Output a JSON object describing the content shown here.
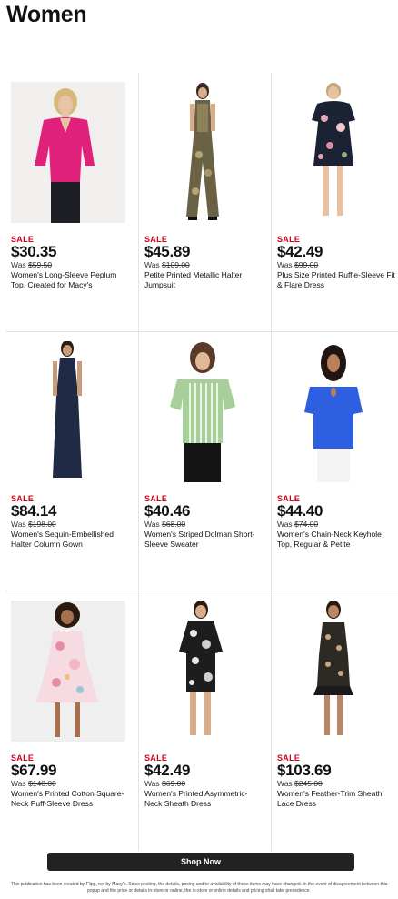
{
  "page": {
    "title": "Women"
  },
  "products": [
    {
      "sale": "SALE",
      "price": "$30.35",
      "was_label": "Was",
      "was_price": "$59.50",
      "name": "Women's Long-Sleeve Peplum Top, Created for Macy's",
      "image": "pink-peplum-top-model"
    },
    {
      "sale": "SALE",
      "price": "$45.89",
      "was_label": "Was",
      "was_price": "$109.00",
      "name": "Petite Printed Metallic Halter Jumpsuit",
      "image": "printed-halter-jumpsuit-model"
    },
    {
      "sale": "SALE",
      "price": "$42.49",
      "was_label": "Was",
      "was_price": "$99.00",
      "name": "Plus Size Printed Ruffle-Sleeve Fit & Flare Dress",
      "image": "floral-flare-dress-model"
    },
    {
      "sale": "SALE",
      "price": "$84.14",
      "was_label": "Was",
      "was_price": "$198.00",
      "name": "Women's Sequin-Embellished Halter Column Gown",
      "image": "navy-halter-gown-model"
    },
    {
      "sale": "SALE",
      "price": "$40.46",
      "was_label": "Was",
      "was_price": "$68.00",
      "name": "Women's Striped Dolman Short-Sleeve Sweater",
      "image": "green-striped-sweater-model"
    },
    {
      "sale": "SALE",
      "price": "$44.40",
      "was_label": "Was",
      "was_price": "$74.00",
      "name": "Women's Chain-Neck Keyhole Top, Regular & Petite",
      "image": "blue-keyhole-top-model"
    },
    {
      "sale": "SALE",
      "price": "$67.99",
      "was_label": "Was",
      "was_price": "$148.00",
      "name": "Women's Printed Cotton Square-Neck Puff-Sleeve Dress",
      "image": "floral-puff-sleeve-dress-model"
    },
    {
      "sale": "SALE",
      "price": "$42.49",
      "was_label": "Was",
      "was_price": "$69.00",
      "name": "Women's Printed Asymmetric-Neck Sheath Dress",
      "image": "black-print-sheath-dress-model"
    },
    {
      "sale": "SALE",
      "price": "$103.69",
      "was_label": "Was",
      "was_price": "$245.00",
      "name": "Women's Feather-Trim Sheath Lace Dress",
      "image": "lace-feather-dress-model"
    }
  ],
  "cta": {
    "label": "Shop Now"
  },
  "footer": {
    "disclaimer": "This publication has been created by Flipp, not by Macy's. Since posting, the details, pricing and/or availability of these items may have changed. In the event of disagreement between this popup and the price or details in-store or online, the in-store or online details and pricing shall take precedence."
  },
  "colors": {
    "sale": "#d0021b",
    "button": "#222222",
    "divider": "#e4e4e4"
  }
}
